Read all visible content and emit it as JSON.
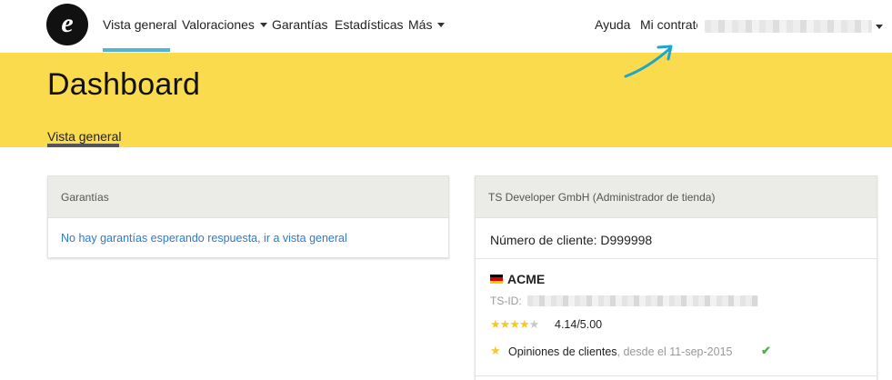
{
  "nav": {
    "logo_letter": "e",
    "items": [
      {
        "label": "Vista general",
        "active": true
      },
      {
        "label": "Valoraciones",
        "dropdown": true
      },
      {
        "label": "Garantías"
      },
      {
        "label": "Estadísticas"
      },
      {
        "label": "Más",
        "dropdown": true
      }
    ],
    "right": {
      "help": "Ayuda",
      "contract": "Mi contrato"
    },
    "accent_color": "#4fb6d6"
  },
  "header": {
    "title": "Dashboard",
    "tab": "Vista general",
    "background_color": "#fadb4d",
    "arrow_color": "#1fa6c9"
  },
  "guarantees_card": {
    "title": "Garantías",
    "message": "No hay garantías esperando respuesta, ir a vista general"
  },
  "account_card": {
    "title": "TS Developer GmbH (Administrador de tienda)",
    "client_number": "Número de cliente: D999998",
    "shop": {
      "flag": "germany-flag",
      "name": "ACME",
      "tsid_label": "TS-ID:",
      "stars_filled": 4,
      "stars_total": 5,
      "rating": "4.14/5.00",
      "reviews_label": "Opiniones de clientes",
      "reviews_since": ", desde el 11-sep-2015",
      "reviews_status": "check-icon"
    }
  }
}
